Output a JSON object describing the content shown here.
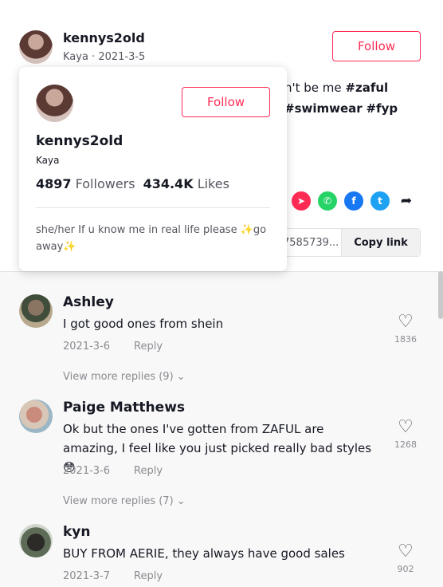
{
  "post": {
    "author_name": "kennys2old",
    "author_sub": "Kaya · 2021-3-5",
    "follow_label": "Follow",
    "caption_line1_pre": "n't be me ",
    "caption_line1_tag": "#zaful",
    "caption_line2_tag1": "#swimwear",
    "caption_line2_tag2": "#fyp",
    "link_text": "7585739...",
    "copy_link_label": "Copy link"
  },
  "popover": {
    "name": "kennys2old",
    "nickname": "Kaya",
    "follow_label": "Follow",
    "followers_count": "4897",
    "followers_label": "Followers",
    "likes_count": "434.4K",
    "likes_label": "Likes",
    "bio_part1": "she/her If u know me in real life please ",
    "bio_part2": "go away"
  },
  "comments": [
    {
      "name": "Ashley",
      "text": "I got good ones from shein",
      "date": "2021-3-6",
      "reply": "Reply",
      "likes": "1836",
      "view_more": "View more replies (9)"
    },
    {
      "name": "Paige Matthews",
      "text": "Ok but the ones I've gotten from ZAFUL are amazing, I feel like you just picked really bad styles 😳",
      "date": "2021-3-6",
      "reply": "Reply",
      "likes": "1268",
      "view_more": "View more replies (7)"
    },
    {
      "name": "kyn",
      "text": "BUY FROM AERIE, they always have good sales",
      "date": "2021-3-7",
      "reply": "Reply",
      "likes": "902"
    }
  ],
  "colors": {
    "accent": "#fe2c55",
    "text": "#161823",
    "muted": "#8a8b91"
  }
}
